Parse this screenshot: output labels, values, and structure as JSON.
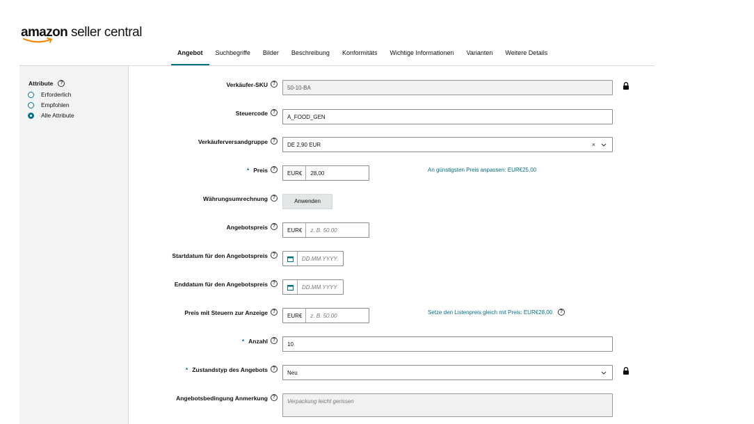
{
  "logo": {
    "brand": "amazon",
    "rest": " seller central"
  },
  "tabs": [
    {
      "label": "Angebot",
      "active": true
    },
    {
      "label": "Suchbegriffe"
    },
    {
      "label": "Bilder"
    },
    {
      "label": "Beschreibung"
    },
    {
      "label": "Konformitäts"
    },
    {
      "label": "Wichtige Informationen"
    },
    {
      "label": "Varianten"
    },
    {
      "label": "Weitere Details"
    }
  ],
  "sidebar": {
    "title": "Attribute",
    "options": [
      {
        "label": "Erforderlich",
        "checked": false
      },
      {
        "label": "Empfohlen",
        "checked": false
      },
      {
        "label": "Alle Attribute",
        "checked": true
      }
    ]
  },
  "form": {
    "sku": {
      "label": "Verkäufer-SKU",
      "value": "50-10-BA"
    },
    "tax": {
      "label": "Steuercode",
      "value": "A_FOOD_GEN"
    },
    "shipping": {
      "label": "Verkäuferversandgruppe",
      "value": "DE 2,90 EUR",
      "clear": "×"
    },
    "price": {
      "label": "Preis",
      "required": "*",
      "currency": "EUR€",
      "value": "28,00",
      "link": "An günstigsten Preis anpassen: EUR€25,00"
    },
    "conversion": {
      "label": "Währungsumrechnung",
      "button": "Anwenden"
    },
    "sale_price": {
      "label": "Angebotspreis",
      "currency": "EUR€",
      "placeholder": "z. B. 50.00"
    },
    "sale_start": {
      "label": "Startdatum für den Angebotspreis",
      "placeholder": "DD.MM.YYYY"
    },
    "sale_end": {
      "label": "Enddatum für den Angebotspreis",
      "placeholder": "DD.MM.YYYY"
    },
    "tax_price": {
      "label": "Preis mit Steuern zur Anzeige",
      "currency": "EUR€",
      "placeholder": "z. B. 50.00",
      "link": "Setze den Listenpreis gleich mit Preis: EUR€28,00"
    },
    "quantity": {
      "label": "Anzahl",
      "required": "*",
      "value": "10"
    },
    "condition": {
      "label": "Zustandstyp des Angebots",
      "required": "*",
      "value": "Neu"
    },
    "condition_note": {
      "label": "Angebotsbedingung Anmerkung",
      "placeholder": "Verpackung leicht gerissen"
    }
  },
  "colors": {
    "accent": "#007185",
    "sidebar_bg": "#f2f4f4"
  }
}
